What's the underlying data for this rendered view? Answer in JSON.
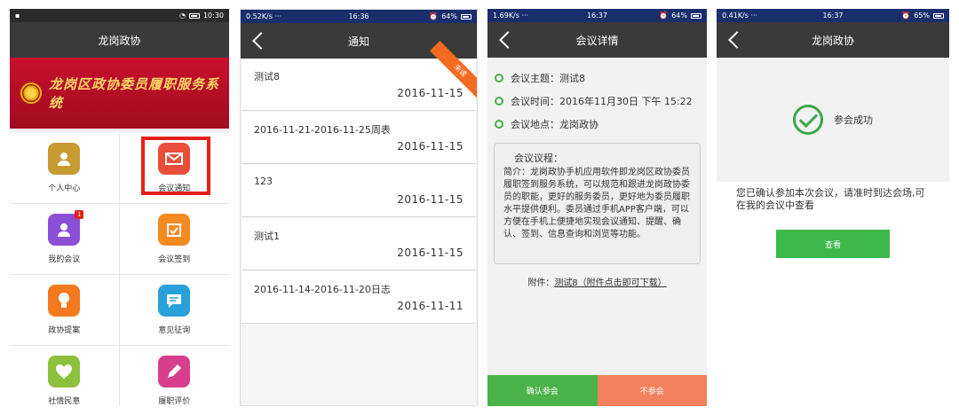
{
  "screen1": {
    "status_time": "10:30",
    "title": "龙岗政协",
    "banner_text": "龙岗区政协委员履职服务系统",
    "tiles": [
      {
        "label": "个人中心"
      },
      {
        "label": "会议通知"
      },
      {
        "label": "我的会议",
        "badge": "1"
      },
      {
        "label": "会议签到"
      },
      {
        "label": "政协提案"
      },
      {
        "label": "意见征询"
      },
      {
        "label": "社情民意"
      },
      {
        "label": "履职评价"
      }
    ]
  },
  "screen2": {
    "status_speed": "0.52K/s ···",
    "status_time": "16:36",
    "status_battery": "64%",
    "title": "通知",
    "unread_label": "未读",
    "items": [
      {
        "title": "测试8",
        "date": "2016-11-15"
      },
      {
        "title": "2016-11-21-2016-11-25周表",
        "date": "2016-11-15"
      },
      {
        "title": "123",
        "date": "2016-11-15"
      },
      {
        "title": "测试1",
        "date": "2016-11-15"
      },
      {
        "title": "2016-11-14-2016-11-20日志",
        "date": "2016-11-11"
      }
    ]
  },
  "screen3": {
    "status_speed": "1.69K/s ···",
    "status_time": "16:37",
    "status_battery": "64%",
    "title": "会议详情",
    "topic": "会议主题：测试8",
    "time": "会议时间：2016年11月30日 下午 15:22",
    "place": "会议地点：龙岗政协",
    "agenda_title": "会议议程：",
    "agenda_body": "简介：龙岗政协手机应用软件即龙岗区政协委员履职签到服务系统，可以规范和跟进龙岗政协委员的职能，更好的服务委员，更好地为委员履职水平提供便利。委员通过手机APP客户端，可以方便在手机上便捷地实现会议通知、提醒、确认、签到、信息查询和浏览等功能。",
    "attach_label": "附件：",
    "attach_link": "测试8（附件点击即可下载）",
    "confirm_label": "确认参会",
    "decline_label": "不参会"
  },
  "screen4": {
    "status_speed": "0.41K/s ···",
    "status_time": "16:37",
    "status_battery": "65%",
    "title": "龙岗政协",
    "success_text": "参会成功",
    "message": "您已确认参加本次会议，请准时到达会场,可在我的会议中查看",
    "view_label": "查看"
  },
  "colors": {
    "nav": "#3a3a3a",
    "banner": "#c8102e",
    "accent_green": "#4cb34a",
    "accent_orange": "#f2815e",
    "highlight": "#e3201b"
  }
}
